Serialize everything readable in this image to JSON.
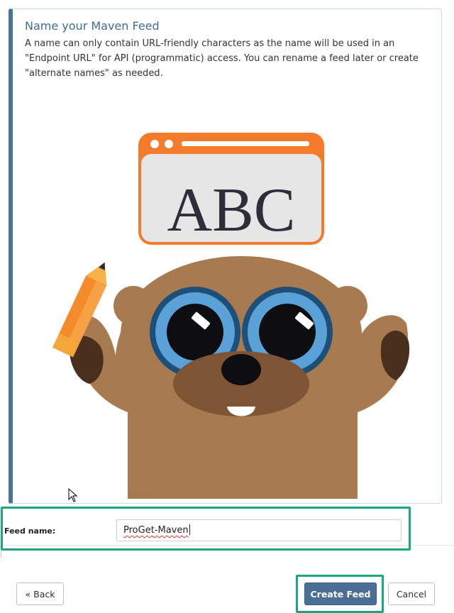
{
  "info": {
    "title": "Name your Maven Feed",
    "description": "A name can only contain URL-friendly characters as the name will be used in an \"Endpoint URL\" for API (programmatic) access. You can rename a feed later or create \"alternate names\" as needed."
  },
  "illustration": {
    "window_text": "ABC",
    "colors": {
      "window_frame": "#f47b2b",
      "window_fill": "#e6e6e6",
      "body": "#a87a50",
      "dark": "#4a2f1c",
      "eye_ring": "#1e4f78",
      "eye_iris": "#5aa1d7"
    }
  },
  "form": {
    "feed_name_label": "Feed name:",
    "feed_name_value": "ProGet-Maven"
  },
  "buttons": {
    "back_label": "« Back",
    "create_label": "Create Feed",
    "cancel_label": "Cancel"
  },
  "colors": {
    "accent": "#4a7497",
    "primary_button": "#4b6e96",
    "highlight": "#1ea67e"
  }
}
